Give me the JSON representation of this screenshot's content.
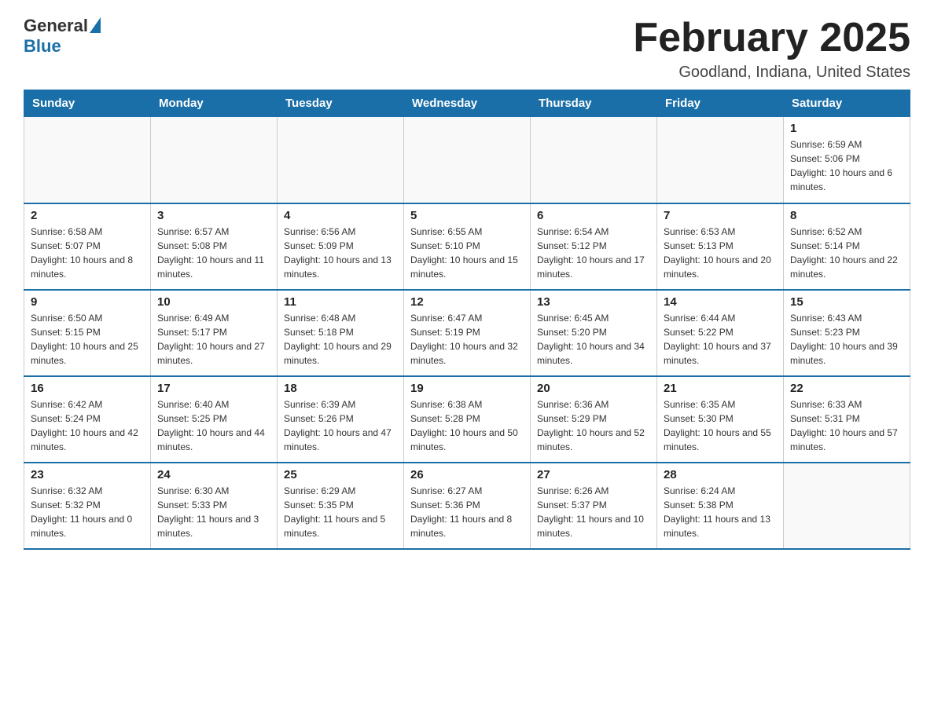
{
  "logo": {
    "general": "General",
    "blue": "Blue"
  },
  "title": "February 2025",
  "location": "Goodland, Indiana, United States",
  "days_of_week": [
    "Sunday",
    "Monday",
    "Tuesday",
    "Wednesday",
    "Thursday",
    "Friday",
    "Saturday"
  ],
  "weeks": [
    [
      {
        "day": "",
        "info": ""
      },
      {
        "day": "",
        "info": ""
      },
      {
        "day": "",
        "info": ""
      },
      {
        "day": "",
        "info": ""
      },
      {
        "day": "",
        "info": ""
      },
      {
        "day": "",
        "info": ""
      },
      {
        "day": "1",
        "info": "Sunrise: 6:59 AM\nSunset: 5:06 PM\nDaylight: 10 hours and 6 minutes."
      }
    ],
    [
      {
        "day": "2",
        "info": "Sunrise: 6:58 AM\nSunset: 5:07 PM\nDaylight: 10 hours and 8 minutes."
      },
      {
        "day": "3",
        "info": "Sunrise: 6:57 AM\nSunset: 5:08 PM\nDaylight: 10 hours and 11 minutes."
      },
      {
        "day": "4",
        "info": "Sunrise: 6:56 AM\nSunset: 5:09 PM\nDaylight: 10 hours and 13 minutes."
      },
      {
        "day": "5",
        "info": "Sunrise: 6:55 AM\nSunset: 5:10 PM\nDaylight: 10 hours and 15 minutes."
      },
      {
        "day": "6",
        "info": "Sunrise: 6:54 AM\nSunset: 5:12 PM\nDaylight: 10 hours and 17 minutes."
      },
      {
        "day": "7",
        "info": "Sunrise: 6:53 AM\nSunset: 5:13 PM\nDaylight: 10 hours and 20 minutes."
      },
      {
        "day": "8",
        "info": "Sunrise: 6:52 AM\nSunset: 5:14 PM\nDaylight: 10 hours and 22 minutes."
      }
    ],
    [
      {
        "day": "9",
        "info": "Sunrise: 6:50 AM\nSunset: 5:15 PM\nDaylight: 10 hours and 25 minutes."
      },
      {
        "day": "10",
        "info": "Sunrise: 6:49 AM\nSunset: 5:17 PM\nDaylight: 10 hours and 27 minutes."
      },
      {
        "day": "11",
        "info": "Sunrise: 6:48 AM\nSunset: 5:18 PM\nDaylight: 10 hours and 29 minutes."
      },
      {
        "day": "12",
        "info": "Sunrise: 6:47 AM\nSunset: 5:19 PM\nDaylight: 10 hours and 32 minutes."
      },
      {
        "day": "13",
        "info": "Sunrise: 6:45 AM\nSunset: 5:20 PM\nDaylight: 10 hours and 34 minutes."
      },
      {
        "day": "14",
        "info": "Sunrise: 6:44 AM\nSunset: 5:22 PM\nDaylight: 10 hours and 37 minutes."
      },
      {
        "day": "15",
        "info": "Sunrise: 6:43 AM\nSunset: 5:23 PM\nDaylight: 10 hours and 39 minutes."
      }
    ],
    [
      {
        "day": "16",
        "info": "Sunrise: 6:42 AM\nSunset: 5:24 PM\nDaylight: 10 hours and 42 minutes."
      },
      {
        "day": "17",
        "info": "Sunrise: 6:40 AM\nSunset: 5:25 PM\nDaylight: 10 hours and 44 minutes."
      },
      {
        "day": "18",
        "info": "Sunrise: 6:39 AM\nSunset: 5:26 PM\nDaylight: 10 hours and 47 minutes."
      },
      {
        "day": "19",
        "info": "Sunrise: 6:38 AM\nSunset: 5:28 PM\nDaylight: 10 hours and 50 minutes."
      },
      {
        "day": "20",
        "info": "Sunrise: 6:36 AM\nSunset: 5:29 PM\nDaylight: 10 hours and 52 minutes."
      },
      {
        "day": "21",
        "info": "Sunrise: 6:35 AM\nSunset: 5:30 PM\nDaylight: 10 hours and 55 minutes."
      },
      {
        "day": "22",
        "info": "Sunrise: 6:33 AM\nSunset: 5:31 PM\nDaylight: 10 hours and 57 minutes."
      }
    ],
    [
      {
        "day": "23",
        "info": "Sunrise: 6:32 AM\nSunset: 5:32 PM\nDaylight: 11 hours and 0 minutes."
      },
      {
        "day": "24",
        "info": "Sunrise: 6:30 AM\nSunset: 5:33 PM\nDaylight: 11 hours and 3 minutes."
      },
      {
        "day": "25",
        "info": "Sunrise: 6:29 AM\nSunset: 5:35 PM\nDaylight: 11 hours and 5 minutes."
      },
      {
        "day": "26",
        "info": "Sunrise: 6:27 AM\nSunset: 5:36 PM\nDaylight: 11 hours and 8 minutes."
      },
      {
        "day": "27",
        "info": "Sunrise: 6:26 AM\nSunset: 5:37 PM\nDaylight: 11 hours and 10 minutes."
      },
      {
        "day": "28",
        "info": "Sunrise: 6:24 AM\nSunset: 5:38 PM\nDaylight: 11 hours and 13 minutes."
      },
      {
        "day": "",
        "info": ""
      }
    ]
  ]
}
